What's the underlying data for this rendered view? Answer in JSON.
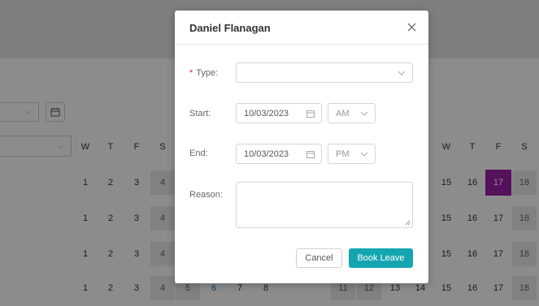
{
  "modal": {
    "title": "Daniel Flanagan",
    "type_label": "Type",
    "type_value": "",
    "start_label": "Start",
    "start_date": "10/03/2023",
    "start_period": "AM",
    "end_label": "End",
    "end_date": "10/03/2023",
    "end_period": "PM",
    "reason_label": "Reason",
    "reason_value": "",
    "cancel_label": "Cancel",
    "book_label": "Book Leave"
  },
  "background": {
    "weekday_headers_left": [
      "W",
      "T",
      "F",
      "S"
    ],
    "weekday_headers_right": [
      "W",
      "T",
      "F",
      "S"
    ],
    "rows_left": [
      [
        "1",
        "2",
        "3",
        "4"
      ],
      [
        "1",
        "2",
        "3",
        "4"
      ],
      [
        "1",
        "2",
        "3",
        "4"
      ],
      [
        "1",
        "2",
        "3",
        "4",
        "5",
        "6",
        "7",
        "8"
      ]
    ],
    "rows_right": [
      [
        "15",
        "16",
        "17",
        "18"
      ],
      [
        "15",
        "16",
        "17",
        "18"
      ],
      [
        "15",
        "16",
        "17",
        "18"
      ],
      [
        "11",
        "12",
        "13",
        "14"
      ],
      [
        "15",
        "16",
        "17",
        "18"
      ]
    ],
    "highlight_color": "#9b1fa6"
  },
  "colors": {
    "accent": "#14a6b0",
    "required": "#e02020"
  }
}
